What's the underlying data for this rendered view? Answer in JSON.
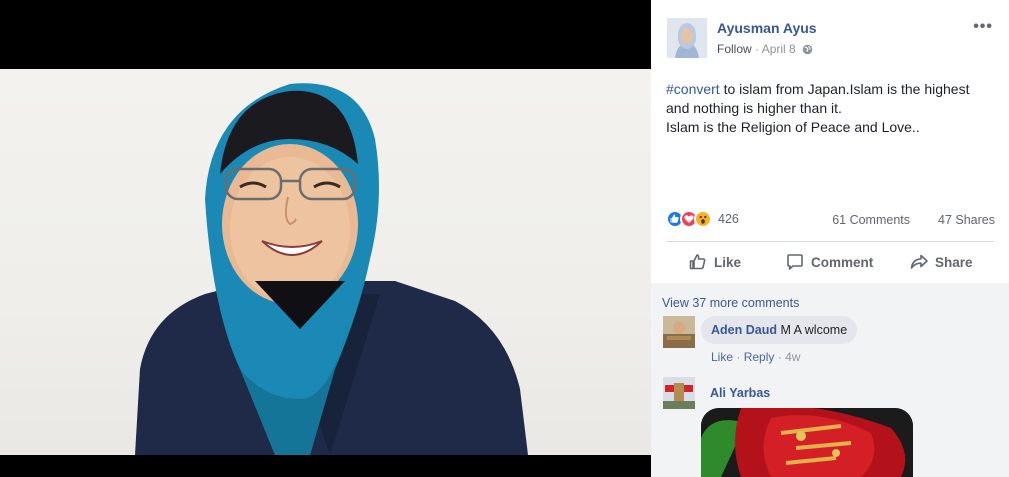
{
  "post": {
    "author": "Ayusman Ayus",
    "follow_label": "Follow",
    "separator": "·",
    "date": "April 8",
    "more_icon": "•••",
    "hashtag": "#convert",
    "text_line1": " to islam from Japan.Islam is the highest",
    "text_line2": "and nothing is higher than it.",
    "text_line3": "Islam is the Religion of Peace and Love..",
    "reaction_icons": [
      "like-icon",
      "love-icon",
      "wow-icon"
    ],
    "reaction_count": "426",
    "comments_count": "61 Comments",
    "shares_count": "47 Shares"
  },
  "actions": {
    "like": "Like",
    "comment": "Comment",
    "share": "Share"
  },
  "comments": {
    "view_more": "View 37 more comments",
    "items": [
      {
        "name": "Aden Daud",
        "text": "M A wlcome",
        "like": "Like",
        "reply": "Reply",
        "dot": "·",
        "time": "4w"
      },
      {
        "name": "Ali Yarbas"
      }
    ]
  },
  "colors": {
    "link": "#365899",
    "like_blue": "#1877f2",
    "love_red": "#f33e58",
    "wow_yellow": "#f7b125",
    "hijab": "#1b89b5",
    "jacket": "#1e2a48"
  }
}
